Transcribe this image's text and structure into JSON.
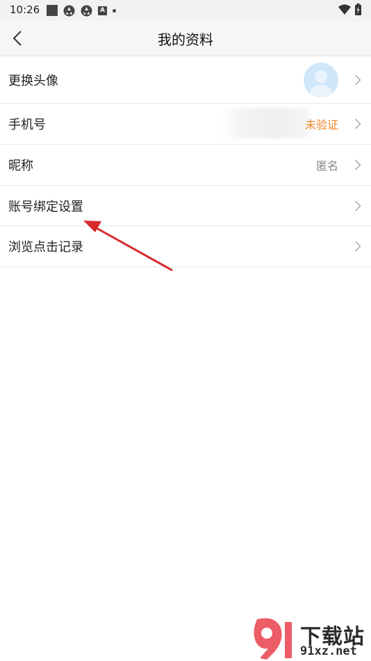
{
  "status_bar": {
    "time": "10:26"
  },
  "header": {
    "title": "我的资料",
    "back_icon": "chevron-left-icon"
  },
  "rows": [
    {
      "label": "更换头像",
      "value": ""
    },
    {
      "label": "手机号",
      "value": "未验证"
    },
    {
      "label": "昵称",
      "value": "匿名"
    },
    {
      "label": "账号绑定设置",
      "value": ""
    },
    {
      "label": "浏览点击记录",
      "value": ""
    }
  ],
  "watermark": {
    "title": "下载站",
    "domain": "91xz.net"
  },
  "colors": {
    "warn": "#f0852a",
    "avatar_bg": "#cfe6fa",
    "arrow": "#d9282b"
  }
}
